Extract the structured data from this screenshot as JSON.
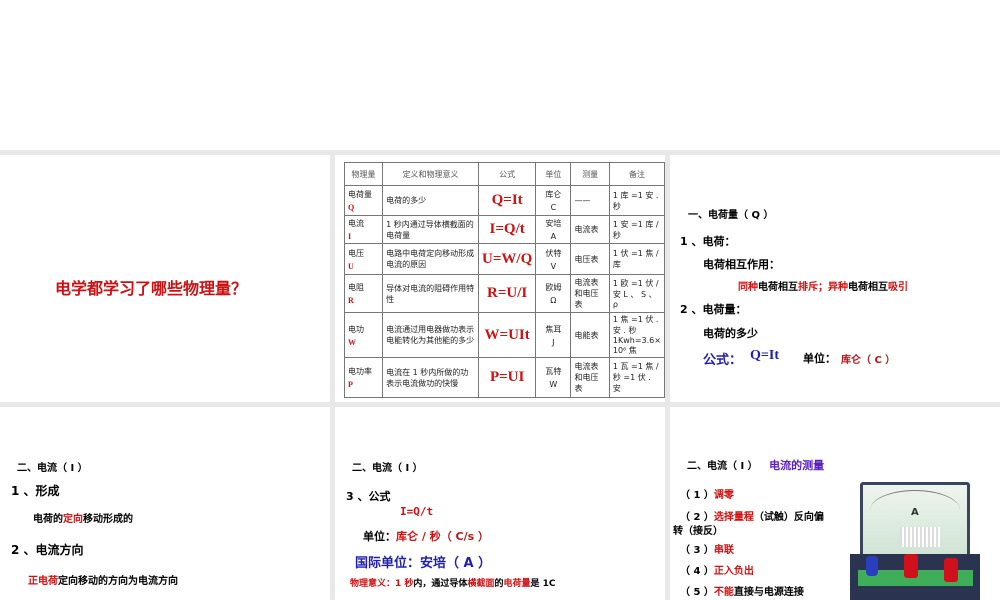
{
  "slide2": {
    "title": "电学都学习了哪些物理量？"
  },
  "table": {
    "headers": [
      "物理量",
      "定义和物理意义",
      "公式",
      "单位",
      "测量",
      "备注"
    ],
    "rows": [
      {
        "name": "电荷量",
        "symbol": "Q",
        "definition": "电荷的多少",
        "formula": "Q=It",
        "unit": "库仑",
        "unit_symbol": "C",
        "measure": "——",
        "note": "1 库 =1 安 . 秒"
      },
      {
        "name": "电流",
        "symbol": "I",
        "definition": "1 秒内通过导体横截面的电荷量",
        "formula": "I=Q/t",
        "unit": "安培",
        "unit_symbol": "A",
        "measure": "电流表",
        "note": "1 安 =1 库 / 秒"
      },
      {
        "name": "电压",
        "symbol": "U",
        "definition": "电路中电荷定向移动形成电流的原因",
        "formula": "U=W/Q",
        "unit": "伏特",
        "unit_symbol": "V",
        "measure": "电压表",
        "note": "1 伏 =1 焦 / 库"
      },
      {
        "name": "电阻",
        "symbol": "R",
        "definition": "导体对电流的阻碍作用特性",
        "formula": "R=U/I",
        "unit": "欧姆",
        "unit_symbol": "Ω",
        "measure": "电流表和电压表",
        "note": "1 欧 =1 伏 / 安 L 、 S 、 ρ"
      },
      {
        "name": "电功",
        "symbol": "W",
        "definition": "电流通过用电器做功表示电能转化为其他能的多少",
        "formula": "W=UIt",
        "unit": "焦耳",
        "unit_symbol": "J",
        "measure": "电能表",
        "note": "1 焦 =1 伏 . 安 . 秒 1Kwh=3.6× 10⁶ 焦"
      },
      {
        "name": "电功率",
        "symbol": "P",
        "definition": "电流在 1 秒内所做的功 表示电流做功的快慢",
        "formula": "P=UI",
        "unit": "瓦特",
        "unit_symbol": "W",
        "measure": "电流表和电压表",
        "note": "1 瓦 =1 焦 / 秒 =1 伏 . 安"
      }
    ]
  },
  "slide4": {
    "heading": "一、电荷量（ Q ）",
    "item1": "1 、电荷：",
    "interaction": "电荷相互作用：",
    "rule": [
      "同种",
      "电荷相互",
      "排斥；异种",
      "电荷相互",
      "吸引"
    ],
    "item2": "2 、电荷量：",
    "desc": "电荷的多少",
    "formula_label": "公式：",
    "formula": "Q=It",
    "unit_label": "单位：",
    "unit": "库仑（ C ）"
  },
  "slide5": {
    "heading": "二、电流（ I ）",
    "item1": "1 、形成",
    "formation": [
      "电荷的",
      "定向",
      "移动形成的"
    ],
    "item2": "2 、电流方向",
    "direction": [
      "正电荷",
      "定向移动的方向为电流方向"
    ]
  },
  "slide6": {
    "heading": "二、电流（ I ）",
    "item3": "3 、公式",
    "formula": "I=Q/t",
    "unit_label": "单位：",
    "unit": "库仑 / 秒",
    "unit_symbol": "（ C/s ）",
    "si_unit": "国际单位：安培（ A ）",
    "meaning": [
      "物理意义：",
      "1 秒",
      "内，通过导体",
      "横截面",
      "的",
      "电荷量",
      "是 1C"
    ]
  },
  "slide7": {
    "heading": "二、电流（ I ）",
    "subheading": "电流的测量",
    "steps": [
      {
        "num": "（ 1 ）",
        "red": "调零",
        "rest": ""
      },
      {
        "num": "（ 2 ）",
        "red": "选择量程",
        "rest": "（试触）反向偏"
      },
      {
        "num": "",
        "red": "",
        "rest": "转（接反）"
      },
      {
        "num": "（ 3 ）",
        "red": "串联",
        "rest": ""
      },
      {
        "num": "（ 4 ）",
        "red": "正入负出",
        "rest": ""
      },
      {
        "num": "（ 5 ）",
        "red": "不能",
        "rest": "直接与电源连接"
      }
    ],
    "meter_label": "A"
  },
  "colors": {
    "red": "#d01010",
    "blue": "#2020b0",
    "purple": "#5a1fc0",
    "separator": "#e8e8e8"
  }
}
